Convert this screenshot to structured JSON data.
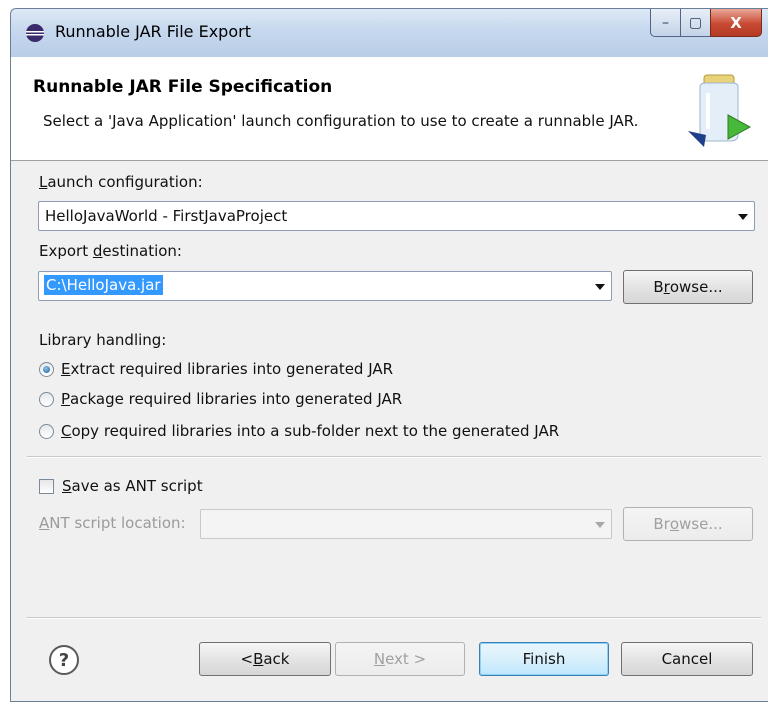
{
  "window": {
    "title": "Runnable JAR File Export",
    "controls": {
      "minimize": "–",
      "maximize": "▢",
      "close": "X"
    }
  },
  "header": {
    "title": "Runnable JAR File Specification",
    "description": "Select a 'Java Application' launch configuration to use to create a runnable JAR."
  },
  "launch_config": {
    "label_pre": "",
    "label_key": "L",
    "label_post": "aunch configuration:",
    "value": "HelloJavaWorld - FirstJavaProject"
  },
  "export_dest": {
    "label_pre": "Export ",
    "label_key": "d",
    "label_post": "estination:",
    "value": "C:\\HelloJava.jar",
    "browse_pre": "B",
    "browse_key": "r",
    "browse_post": "owse..."
  },
  "library": {
    "label": "Library handling:",
    "options": [
      {
        "key": "E",
        "rest": "xtract required libraries into generated JAR",
        "checked": true
      },
      {
        "key": "P",
        "rest": "ackage required libraries into generated JAR",
        "checked": false
      },
      {
        "key": "C",
        "rest": "opy required libraries into a sub-folder next to the generated JAR",
        "checked": false
      }
    ]
  },
  "ant": {
    "save_key": "S",
    "save_rest": "ave as ANT script",
    "location_key": "A",
    "location_rest": "NT script location:",
    "browse_pre": "Br",
    "browse_key": "o",
    "browse_post": "wse..."
  },
  "footer": {
    "help": "?",
    "back_pre": "< ",
    "back_key": "B",
    "back_post": "ack",
    "next_key": "N",
    "next_post": "ext >",
    "finish": "Finish",
    "cancel": "Cancel"
  },
  "icons": [
    "eclipse-app-icon",
    "jar-wizard-icon",
    "help-icon",
    "dropdown-arrow-icon"
  ]
}
